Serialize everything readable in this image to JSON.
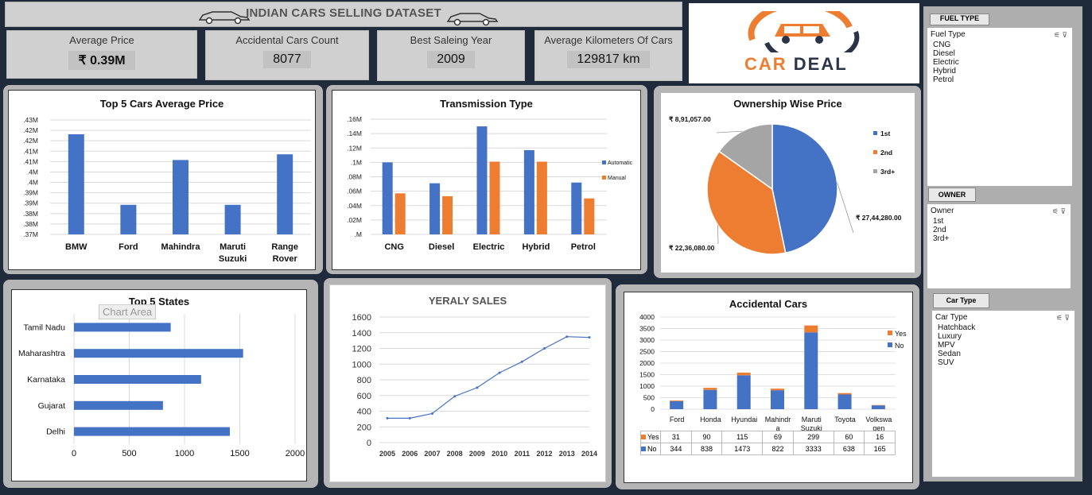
{
  "header": {
    "title": "INDIAN CARS SELLING DATASET"
  },
  "kpis": [
    {
      "label": "Average Price",
      "value": "₹ 0.39M"
    },
    {
      "label": "Accidental Cars Count",
      "value": "8077"
    },
    {
      "label": "Best Saleing Year",
      "value": "2009"
    },
    {
      "label": "Average Kilometers Of Cars",
      "value": "129817 km"
    }
  ],
  "logo": {
    "word1": "CAR",
    "word2": "DEAL"
  },
  "colors": {
    "blue": "#4472c4",
    "orange": "#ed7d31",
    "gray": "#a5a5a5"
  },
  "chart_data": [
    {
      "type": "bar",
      "title": "Top 5 Cars Average Price",
      "categories": [
        "BMW",
        "Ford",
        "Mahindra",
        "Maruti Suzuki",
        "Range Rover"
      ],
      "values": [
        0.4225,
        0.3855,
        0.409,
        0.3855,
        0.412
      ],
      "ylim": [
        0.37,
        0.43
      ],
      "yticks": [
        ".43M",
        ".42M",
        ".42M",
        ".41M",
        ".41M",
        ".4M",
        ".4M",
        ".39M",
        ".39M",
        ".38M",
        ".38M",
        ".37M"
      ]
    },
    {
      "type": "bar",
      "title": "Transmission Type",
      "categories": [
        "CNG",
        "Diesel",
        "Electric",
        "Hybrid",
        "Petrol"
      ],
      "series": [
        {
          "name": "Automatic",
          "values": [
            100000,
            71000,
            150000,
            117000,
            72000
          ]
        },
        {
          "name": "Manual",
          "values": [
            57000,
            53000,
            101000,
            101000,
            50000
          ]
        }
      ],
      "ylim": [
        0,
        160000
      ],
      "yticks": [
        ".M",
        ".02M",
        ".04M",
        ".06M",
        ".08M",
        ".1M",
        ".12M",
        ".14M",
        ".16M"
      ]
    },
    {
      "type": "pie",
      "title": "Ownership Wise Price",
      "slices": [
        {
          "name": "1st",
          "value": 2744280,
          "label": "₹ 27,44,280.00"
        },
        {
          "name": "2nd",
          "value": 2236080,
          "label": "₹ 22,36,080.00"
        },
        {
          "name": "3rd+",
          "value": 891057,
          "label": "₹ 8,91,057.00"
        }
      ]
    },
    {
      "type": "bar",
      "title": "Top 5 States",
      "categories": [
        "Tamil Nadu",
        "Maharashtra",
        "Karnataka",
        "Gujarat",
        "Delhi"
      ],
      "values": [
        875,
        1530,
        1150,
        805,
        1410
      ],
      "xlim": [
        0,
        2000
      ],
      "xticks": [
        "0",
        "500",
        "1000",
        "1500",
        "2000"
      ],
      "tooltip": "Chart Area"
    },
    {
      "type": "line",
      "title": "YERALY SALES",
      "x": [
        "2005",
        "2006",
        "2007",
        "2008",
        "2009",
        "2010",
        "2011",
        "2012",
        "2013",
        "2014"
      ],
      "values": [
        310,
        310,
        370,
        590,
        700,
        890,
        1030,
        1200,
        1350,
        1340
      ],
      "ylim": [
        0,
        1600
      ],
      "yticks": [
        "0",
        "200",
        "400",
        "600",
        "800",
        "1000",
        "1200",
        "1400",
        "1600"
      ]
    },
    {
      "type": "bar",
      "title": "Accidental  Cars",
      "categories": [
        "Ford",
        "Honda",
        "Hyundai",
        "Mahindra",
        "Maruti Suzuki",
        "Toyota",
        "Volkswagen"
      ],
      "category_labels": [
        [
          "Ford"
        ],
        [
          "Honda"
        ],
        [
          "Hyundai"
        ],
        [
          "Mahindr",
          "a"
        ],
        [
          "Maruti",
          "Suzuki"
        ],
        [
          "Toyota"
        ],
        [
          "Volkswa",
          "gen"
        ]
      ],
      "series": [
        {
          "name": "No",
          "values": [
            344,
            838,
            1473,
            822,
            3333,
            638,
            165
          ]
        },
        {
          "name": "Yes",
          "values": [
            31,
            90,
            115,
            69,
            299,
            60,
            16
          ]
        }
      ],
      "ylim": [
        0,
        4000
      ],
      "yticks": [
        "0",
        "500",
        "1000",
        "1500",
        "2000",
        "2500",
        "3000",
        "3500",
        "4000"
      ]
    }
  ],
  "slicers": {
    "fuel": {
      "button": "FUEL TYPE",
      "header": "Fuel Type",
      "items": [
        "CNG",
        "Diesel",
        "Electric",
        "Hybrid",
        "Petrol"
      ]
    },
    "owner": {
      "button": "OWNER",
      "header": "Owner",
      "items": [
        "1st",
        "2nd",
        "3rd+"
      ]
    },
    "cartype": {
      "button": "Car Type",
      "header": "Car Type",
      "items": [
        "Hatchback",
        "Luxury",
        "MPV",
        "Sedan",
        "SUV"
      ]
    }
  }
}
